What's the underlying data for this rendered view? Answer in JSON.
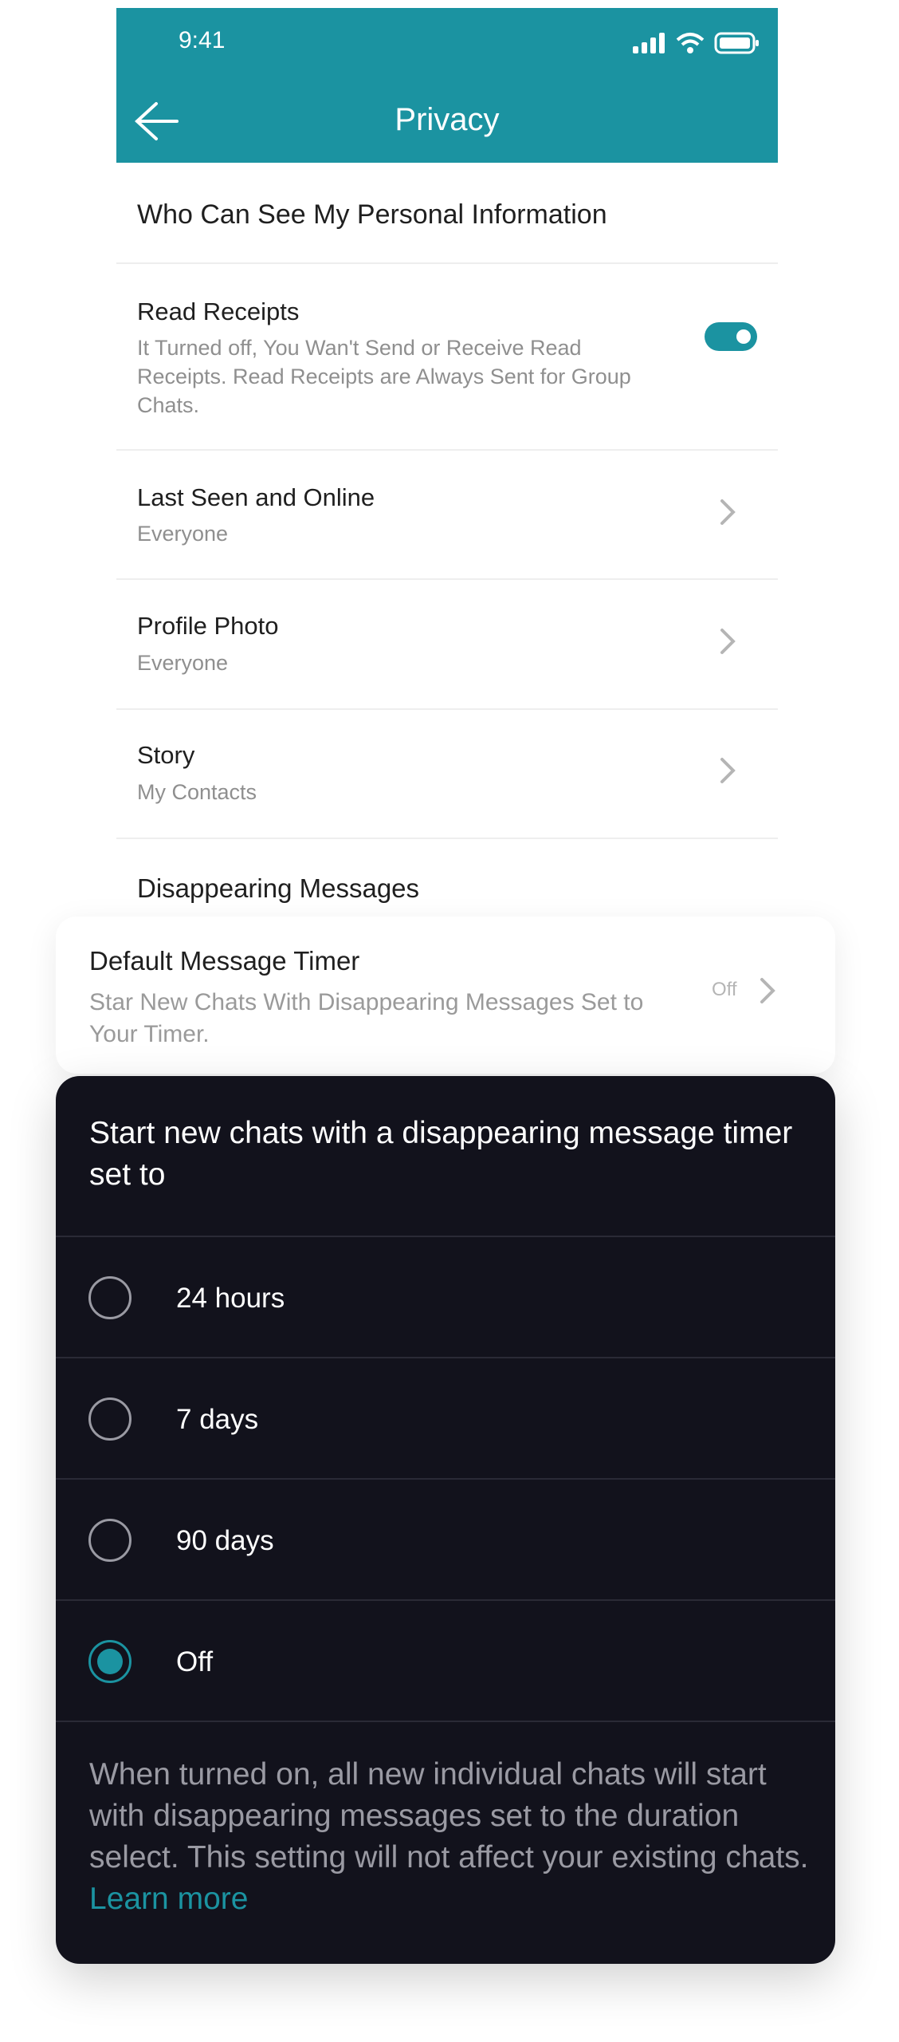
{
  "status_bar": {
    "time": "9:41"
  },
  "header": {
    "title": "Privacy"
  },
  "section_title": "Who Can See My Personal Information",
  "read_receipts": {
    "title": "Read Receipts",
    "description": "It Turned off, You Wan't Send or Receive Read Receipts. Read Receipts are Always Sent for Group Chats.",
    "enabled": true
  },
  "items": [
    {
      "title": "Last Seen and Online",
      "value": "Everyone"
    },
    {
      "title": "Profile Photo",
      "value": "Everyone"
    },
    {
      "title": "Story",
      "value": "My Contacts"
    }
  ],
  "disappearing_section": "Disappearing Messages",
  "timer_card": {
    "title": "Default Message Timer",
    "description": "Star New Chats With Disappearing Messages Set to Your Timer.",
    "value": "Off"
  },
  "sheet": {
    "heading": "Start new chats with a disappearing message timer set to",
    "options": [
      {
        "label": "24 hours",
        "selected": false
      },
      {
        "label": "7 days",
        "selected": false
      },
      {
        "label": "90 days",
        "selected": false
      },
      {
        "label": "Off",
        "selected": true
      }
    ],
    "footer": "When turned on, all new individual chats will start with disappearing messages set to the duration select. This setting will not affect your existing chats.",
    "learn_more": "Learn more"
  },
  "colors": {
    "accent": "#1b93a1",
    "sheet_bg": "#12121c"
  }
}
